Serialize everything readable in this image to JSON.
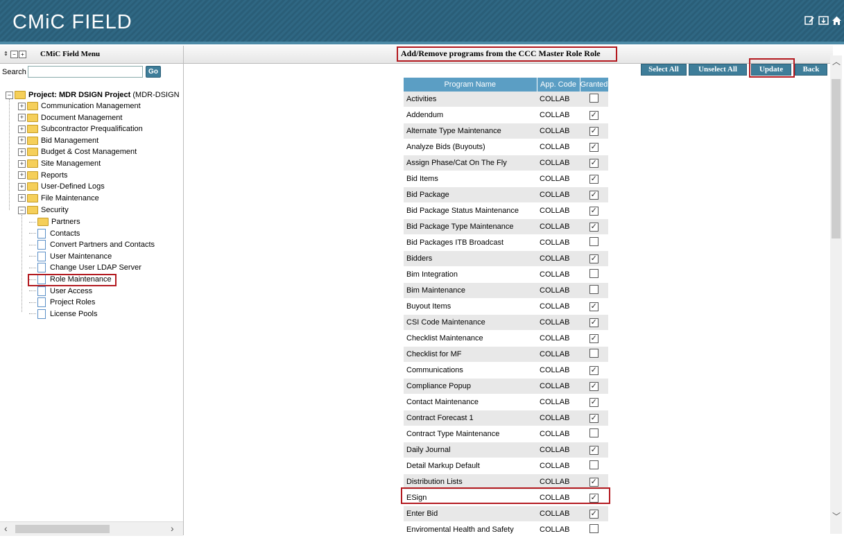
{
  "header": {
    "app_title": "CMiC FIELD",
    "icons": [
      "edit-icon",
      "download-icon",
      "home-icon"
    ]
  },
  "left_panel": {
    "menu_title": "CMiC Field Menu",
    "search_label": "Search",
    "search_value": "",
    "go_label": "Go",
    "project_label": "Project: MDR DSIGN Project",
    "project_suffix": "(MDR-DSIGN",
    "folders": [
      "Communication Management",
      "Document Management",
      "Subcontractor Prequalification",
      "Bid Management",
      "Budget & Cost Management",
      "Site Management",
      "Reports",
      "User-Defined Logs",
      "File Maintenance"
    ],
    "security_label": "Security",
    "security_items": [
      "Partners",
      "Contacts",
      "Convert Partners and Contacts",
      "User Maintenance",
      "Change User LDAP Server",
      "Role Maintenance",
      "User Access",
      "Project Roles",
      "License Pools"
    ],
    "selected_item": "Role Maintenance"
  },
  "main": {
    "title": "Add/Remove programs from the CCC Master Role Role",
    "buttons": {
      "select_all": "Select All",
      "unselect_all": "Unselect All",
      "update": "Update",
      "back": "Back"
    },
    "table": {
      "headers": [
        "Program Name",
        "App. Code",
        "Granted"
      ],
      "rows": [
        {
          "name": "Activities",
          "code": "COLLAB",
          "granted": false
        },
        {
          "name": "Addendum",
          "code": "COLLAB",
          "granted": true
        },
        {
          "name": "Alternate Type Maintenance",
          "code": "COLLAB",
          "granted": true
        },
        {
          "name": "Analyze Bids (Buyouts)",
          "code": "COLLAB",
          "granted": true
        },
        {
          "name": "Assign Phase/Cat On The Fly",
          "code": "COLLAB",
          "granted": true
        },
        {
          "name": "Bid Items",
          "code": "COLLAB",
          "granted": true
        },
        {
          "name": "Bid Package",
          "code": "COLLAB",
          "granted": true
        },
        {
          "name": "Bid Package Status Maintenance",
          "code": "COLLAB",
          "granted": true
        },
        {
          "name": "Bid Package Type Maintenance",
          "code": "COLLAB",
          "granted": true
        },
        {
          "name": "Bid Packages ITB Broadcast",
          "code": "COLLAB",
          "granted": false
        },
        {
          "name": "Bidders",
          "code": "COLLAB",
          "granted": true
        },
        {
          "name": "Bim Integration",
          "code": "COLLAB",
          "granted": false
        },
        {
          "name": "Bim Maintenance",
          "code": "COLLAB",
          "granted": false
        },
        {
          "name": "Buyout Items",
          "code": "COLLAB",
          "granted": true
        },
        {
          "name": "CSI Code Maintenance",
          "code": "COLLAB",
          "granted": true
        },
        {
          "name": "Checklist Maintenance",
          "code": "COLLAB",
          "granted": true
        },
        {
          "name": "Checklist for MF",
          "code": "COLLAB",
          "granted": false
        },
        {
          "name": "Communications",
          "code": "COLLAB",
          "granted": true
        },
        {
          "name": "Compliance Popup",
          "code": "COLLAB",
          "granted": true
        },
        {
          "name": "Contact Maintenance",
          "code": "COLLAB",
          "granted": true
        },
        {
          "name": "Contract Forecast 1",
          "code": "COLLAB",
          "granted": true
        },
        {
          "name": "Contract Type Maintenance",
          "code": "COLLAB",
          "granted": false
        },
        {
          "name": "Daily Journal",
          "code": "COLLAB",
          "granted": true
        },
        {
          "name": "Detail Markup Default",
          "code": "COLLAB",
          "granted": false
        },
        {
          "name": "Distribution Lists",
          "code": "COLLAB",
          "granted": true
        },
        {
          "name": "ESign",
          "code": "COLLAB",
          "granted": true
        },
        {
          "name": "Enter Bid",
          "code": "COLLAB",
          "granted": true
        },
        {
          "name": "Enviromental Health and Safety",
          "code": "COLLAB",
          "granted": false
        }
      ]
    }
  },
  "colors": {
    "header_bg": "#2a5e78",
    "button_bg": "#3e7d99",
    "table_header_bg": "#5b9ec4",
    "highlight_border": "#b3191f"
  }
}
